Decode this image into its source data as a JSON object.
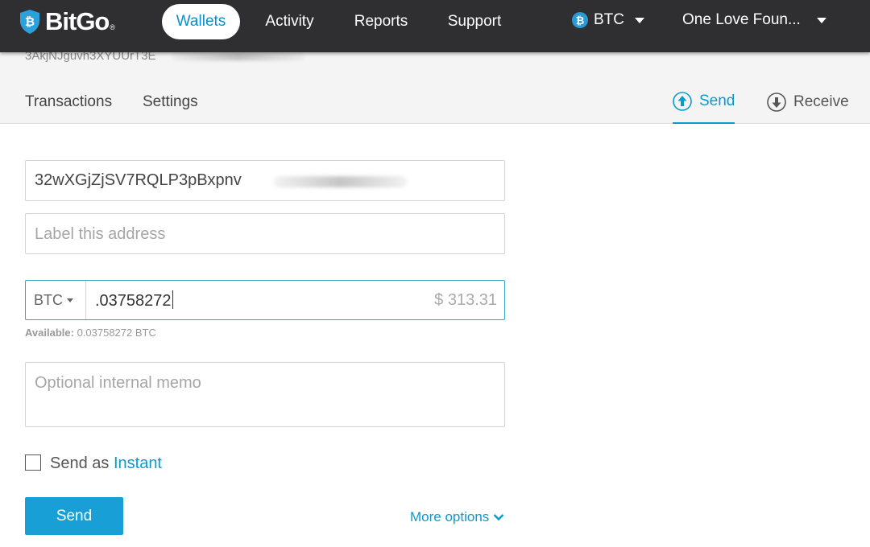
{
  "app": {
    "logo_text": "BitGo",
    "logo_reg": "®"
  },
  "nav": {
    "items": [
      {
        "label": "Wallets",
        "active": true
      },
      {
        "label": "Activity",
        "active": false
      },
      {
        "label": "Reports",
        "active": false
      },
      {
        "label": "Support",
        "active": false
      }
    ],
    "coin": {
      "label": "BTC",
      "icon": "bitcoin-icon"
    },
    "organization": "One Love Foun..."
  },
  "wallet": {
    "address_partial": "3AkjNJguvh3XYUUrT3E"
  },
  "subnav": {
    "tabs": [
      {
        "label": "Transactions"
      },
      {
        "label": "Settings"
      }
    ],
    "actions": [
      {
        "label": "Send",
        "icon": "arrow-up-circle-icon",
        "active": true
      },
      {
        "label": "Receive",
        "icon": "arrow-down-circle-icon",
        "active": false
      }
    ]
  },
  "form": {
    "recipient_address": "32wXGjZjSV7RQLP3pBxpnv",
    "label_placeholder": "Label this address",
    "unit": "BTC",
    "amount": ".03758272",
    "usd_value": "$ 313.31",
    "available_label": "Available:",
    "available_value": "0.03758272 BTC",
    "memo_placeholder": "Optional internal memo",
    "send_as_label": "Send as",
    "instant_label": "Instant",
    "send_button": "Send",
    "more_options": "More options"
  },
  "colors": {
    "topbar": "#2f2f31",
    "accent": "#0a9ad0",
    "send_button": "#18a0d6",
    "subheader_bg": "#f4f4f5"
  }
}
